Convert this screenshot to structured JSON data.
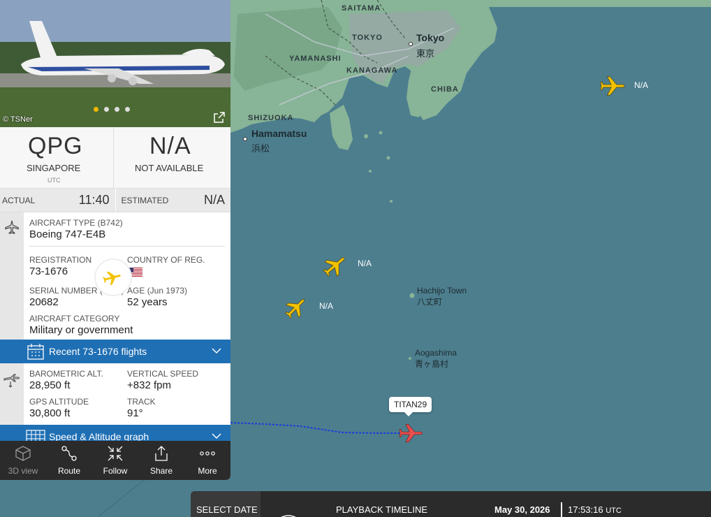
{
  "map": {
    "regions": [
      "SAITAMA",
      "TOKYO",
      "YAMANASHI",
      "KANAGAWA",
      "CHIBA",
      "SHIZUOKA"
    ],
    "cities": {
      "tokyo_en": "Tokyo",
      "tokyo_jp": "東京",
      "hamamatsu_en": "Hamamatsu",
      "hamamatsu_jp": "浜松"
    },
    "islands": {
      "hachijo_en": "Hachijo Town",
      "hachijo_jp": "八丈町",
      "aogashima_en": "Aogashima",
      "aogashima_jp": "青ヶ島村"
    },
    "aircraft": [
      {
        "label": "N/A",
        "color": "#f2c200"
      },
      {
        "label": "N/A",
        "color": "#f2c200"
      },
      {
        "label": "N/A",
        "color": "#f2c200"
      }
    ],
    "selected_callsign": "TITAN29",
    "selected_color": "#e65050",
    "track_color": "#1a3ed8"
  },
  "panel": {
    "photo": {
      "credit": "© TSNer",
      "page_count": 4,
      "active_page": 1
    },
    "origin": {
      "code": "QPG",
      "city": "SINGAPORE",
      "tz": "UTC"
    },
    "destination": {
      "code": "N/A",
      "city": "NOT AVAILABLE"
    },
    "times": {
      "actual_label": "ACTUAL",
      "actual_value": "11:40",
      "estimated_label": "ESTIMATED",
      "estimated_value": "N/A"
    },
    "aircraft": {
      "type_label": "AIRCRAFT TYPE",
      "type_code": "(B742)",
      "type_value": "Boeing 747-E4B",
      "reg_label": "REGISTRATION",
      "reg_value": "73-1676",
      "country_label": "COUNTRY OF REG.",
      "msn_label": "SERIAL NUMBER (MSN)",
      "msn_value": "20682",
      "age_label": "AGE",
      "age_date": "(Jun 1973)",
      "age_value": "52 years",
      "category_label": "AIRCRAFT CATEGORY",
      "category_value": "Military or government"
    },
    "recent_flights": "Recent 73-1676 flights",
    "flight": {
      "baro_label": "BAROMETRIC ALT.",
      "baro_value": "28,950 ft",
      "vs_label": "VERTICAL SPEED",
      "vs_value": "+832 fpm",
      "gps_label": "GPS ALTITUDE",
      "gps_value": "30,800 ft",
      "track_label": "TRACK",
      "track_value": "91°"
    },
    "speed_graph": "Speed & Altitude graph",
    "toolbar": {
      "view3d": "3D view",
      "route": "Route",
      "follow": "Follow",
      "share": "Share",
      "more": "More"
    }
  },
  "playback": {
    "select_date": "SELECT DATE",
    "title": "PLAYBACK TIMELINE",
    "date": "May 30, 2026",
    "time": "17:53:16",
    "tz": "UTC"
  },
  "colors": {
    "accent_blue": "#1f6fb4",
    "toolbar_bg": "#2b2b2b",
    "sea": "#4d7e8e",
    "land": "#7fae8e"
  }
}
